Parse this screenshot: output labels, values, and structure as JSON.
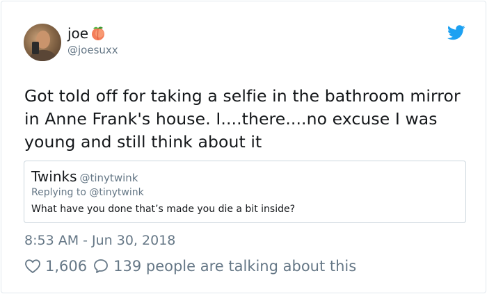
{
  "author": {
    "name": "joe",
    "handle": "@joesuxx",
    "name_emoji": "peach-emoji"
  },
  "tweet": {
    "text": "Got told off for taking a selfie in the bathroom mirror in Anne Frank's house. I....there....no excuse I was young and still think about it",
    "timestamp": "8:53 AM - Jun 30, 2018"
  },
  "quoted": {
    "name": "Twinks",
    "handle": "@tinytwink",
    "replying_to": "Replying to @tinytwink",
    "text": "What have you done that’s made you die a bit inside?"
  },
  "stats": {
    "likes": "1,606",
    "talking": "139 people are talking about this"
  },
  "icons": {
    "brand": "twitter-bird-icon",
    "like": "heart-icon",
    "reply": "speech-bubble-icon"
  },
  "colors": {
    "brand": "#1da1f2",
    "secondary_text": "#657786",
    "primary_text": "#14171a",
    "border": "#e1e8ed"
  }
}
